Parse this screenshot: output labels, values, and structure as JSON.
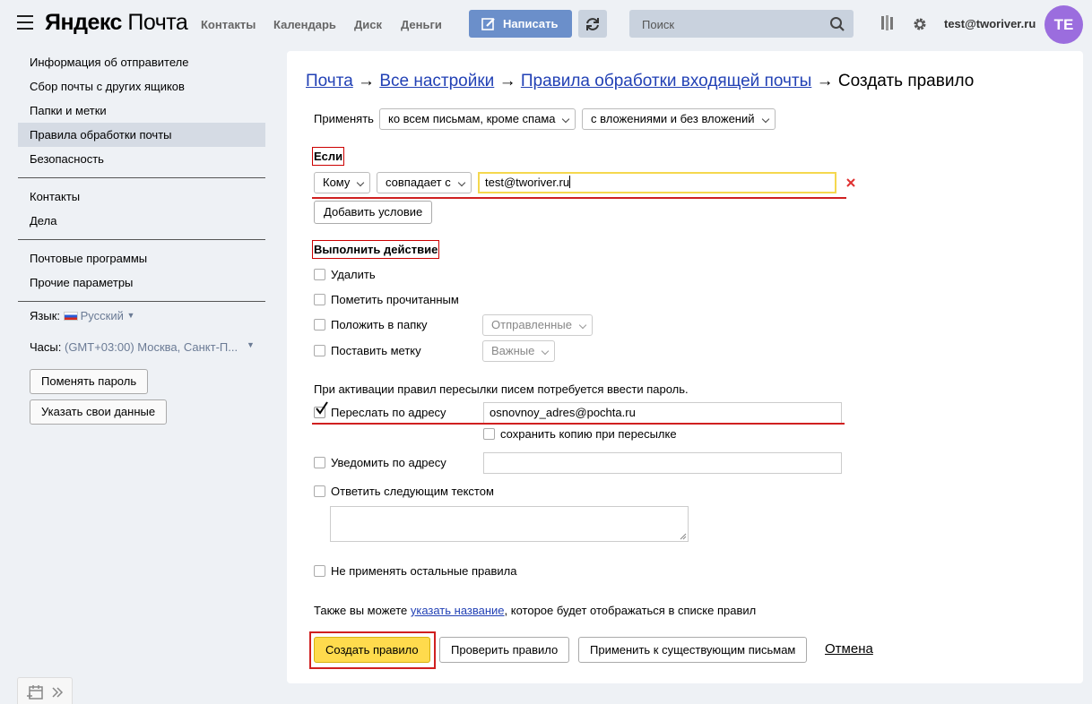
{
  "header": {
    "logo_brand": "Яндекс",
    "logo_product": "Почта",
    "nav": [
      "Контакты",
      "Календарь",
      "Диск",
      "Деньги"
    ],
    "compose_label": "Написать",
    "search_placeholder": "Поиск",
    "user_email": "test@tworiver.ru",
    "avatar_initials": "TE"
  },
  "sidebar": {
    "items_group1": [
      "Информация об отправителе",
      "Сбор почты с других ящиков",
      "Папки и метки",
      "Правила обработки почты",
      "Безопасность"
    ],
    "active_item": "Правила обработки почты",
    "items_group2": [
      "Контакты",
      "Дела"
    ],
    "items_group3": [
      "Почтовые программы",
      "Прочие параметры"
    ],
    "language_label": "Язык:",
    "language_value": "Русский",
    "clock_label": "Часы:",
    "clock_value": "(GMT+03:00) Москва, Санкт-П...",
    "change_password": "Поменять пароль",
    "my_data": "Указать свои данные"
  },
  "main": {
    "breadcrumb": {
      "mail": "Почта",
      "all_settings": "Все настройки",
      "rules": "Правила обработки входящей почты",
      "current": "Создать правило",
      "arrow": "→"
    },
    "apply_label": "Применять",
    "apply_scope": "ко всем письмам, кроме спама",
    "apply_attachments": "с вложениями и без вложений",
    "if_heading": "Если",
    "condition_field": "Кому",
    "condition_op": "совпадает с",
    "condition_value": "test@tworiver.ru",
    "add_condition": "Добавить условие",
    "action_heading": "Выполнить действие",
    "actions": {
      "delete": "Удалить",
      "mark_read": "Пометить прочитанным",
      "move_to_folder": "Положить в папку",
      "folder_value": "Отправленные",
      "set_label": "Поставить метку",
      "label_value": "Важные"
    },
    "forward_note": "При активации правил пересылки писем потребуется ввести пароль.",
    "forward_label": "Переслать по адресу",
    "forward_value": "osnovnoy_adres@pochta.ru",
    "forward_checked": true,
    "keep_copy": "сохранить копию при пересылке",
    "notify_label": "Уведомить по адресу",
    "reply_label": "Ответить следующим текстом",
    "no_other_rules": "Не применять остальные правила",
    "name_text_before": "Также вы можете ",
    "name_link": "указать название",
    "name_text_after": ", которое будет отображаться в списке правил",
    "create_button": "Создать правило",
    "check_button": "Проверить правило",
    "apply_existing_button": "Применить к существующим письмам",
    "cancel_link": "Отмена"
  },
  "colors": {
    "accent_yellow": "#ffdb4d",
    "link_blue": "#2241b5",
    "compose_blue": "#6b8fca",
    "annotation_red": "#d02020",
    "avatar_purple": "#9b6dde"
  }
}
